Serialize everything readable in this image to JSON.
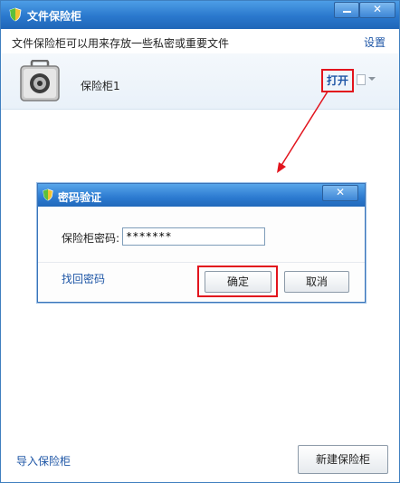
{
  "window": {
    "title": "文件保险柜",
    "min_label": "",
    "close_label": "✕"
  },
  "header": {
    "description": "文件保险柜可以用来存放一些私密或重要文件",
    "settings": "设置"
  },
  "vault": {
    "name": "保险柜1",
    "open": "打开"
  },
  "dialog": {
    "title": "密码验证",
    "close_label": "✕",
    "password_label": "保险柜密码:",
    "password_value": "*******",
    "recover": "找回密码",
    "ok": "确定",
    "cancel": "取消"
  },
  "footer": {
    "import": "导入保险柜",
    "new_vault": "新建保险柜"
  },
  "colors": {
    "titlebar": "#2a78cd",
    "link": "#1e56a6",
    "highlight": "#e2141d"
  },
  "icons": {
    "app": "shield-icon",
    "vault": "safe-icon",
    "menu": "file-menu-icon"
  }
}
